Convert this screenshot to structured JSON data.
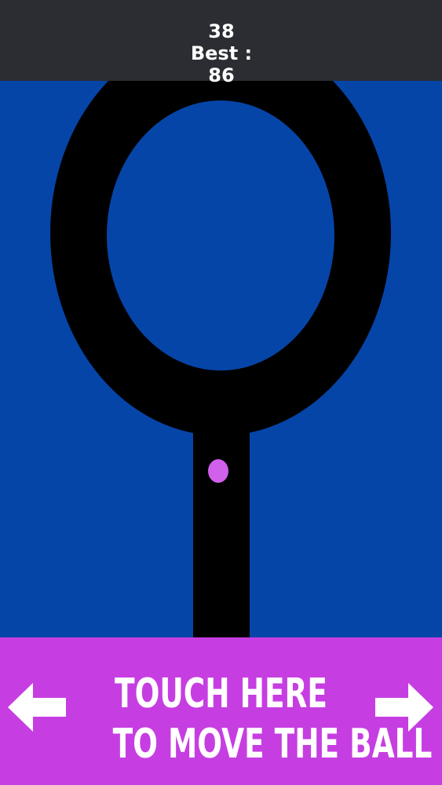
{
  "game": {
    "score": "38",
    "best": "Best : 86"
  },
  "controls": {
    "hint_line_1": "TOUCH HERE",
    "hint_line_2": "TO MOVE THE BALL",
    "left_arrow_icon": "arrow-left-icon",
    "right_arrow_icon": "arrow-right-icon"
  },
  "colors": {
    "background": "#0645a8",
    "header": "#2b2d33",
    "track": "#000000",
    "ball": "#d160eb",
    "control_bar": "#c63ee1",
    "text": "#ffffff"
  }
}
